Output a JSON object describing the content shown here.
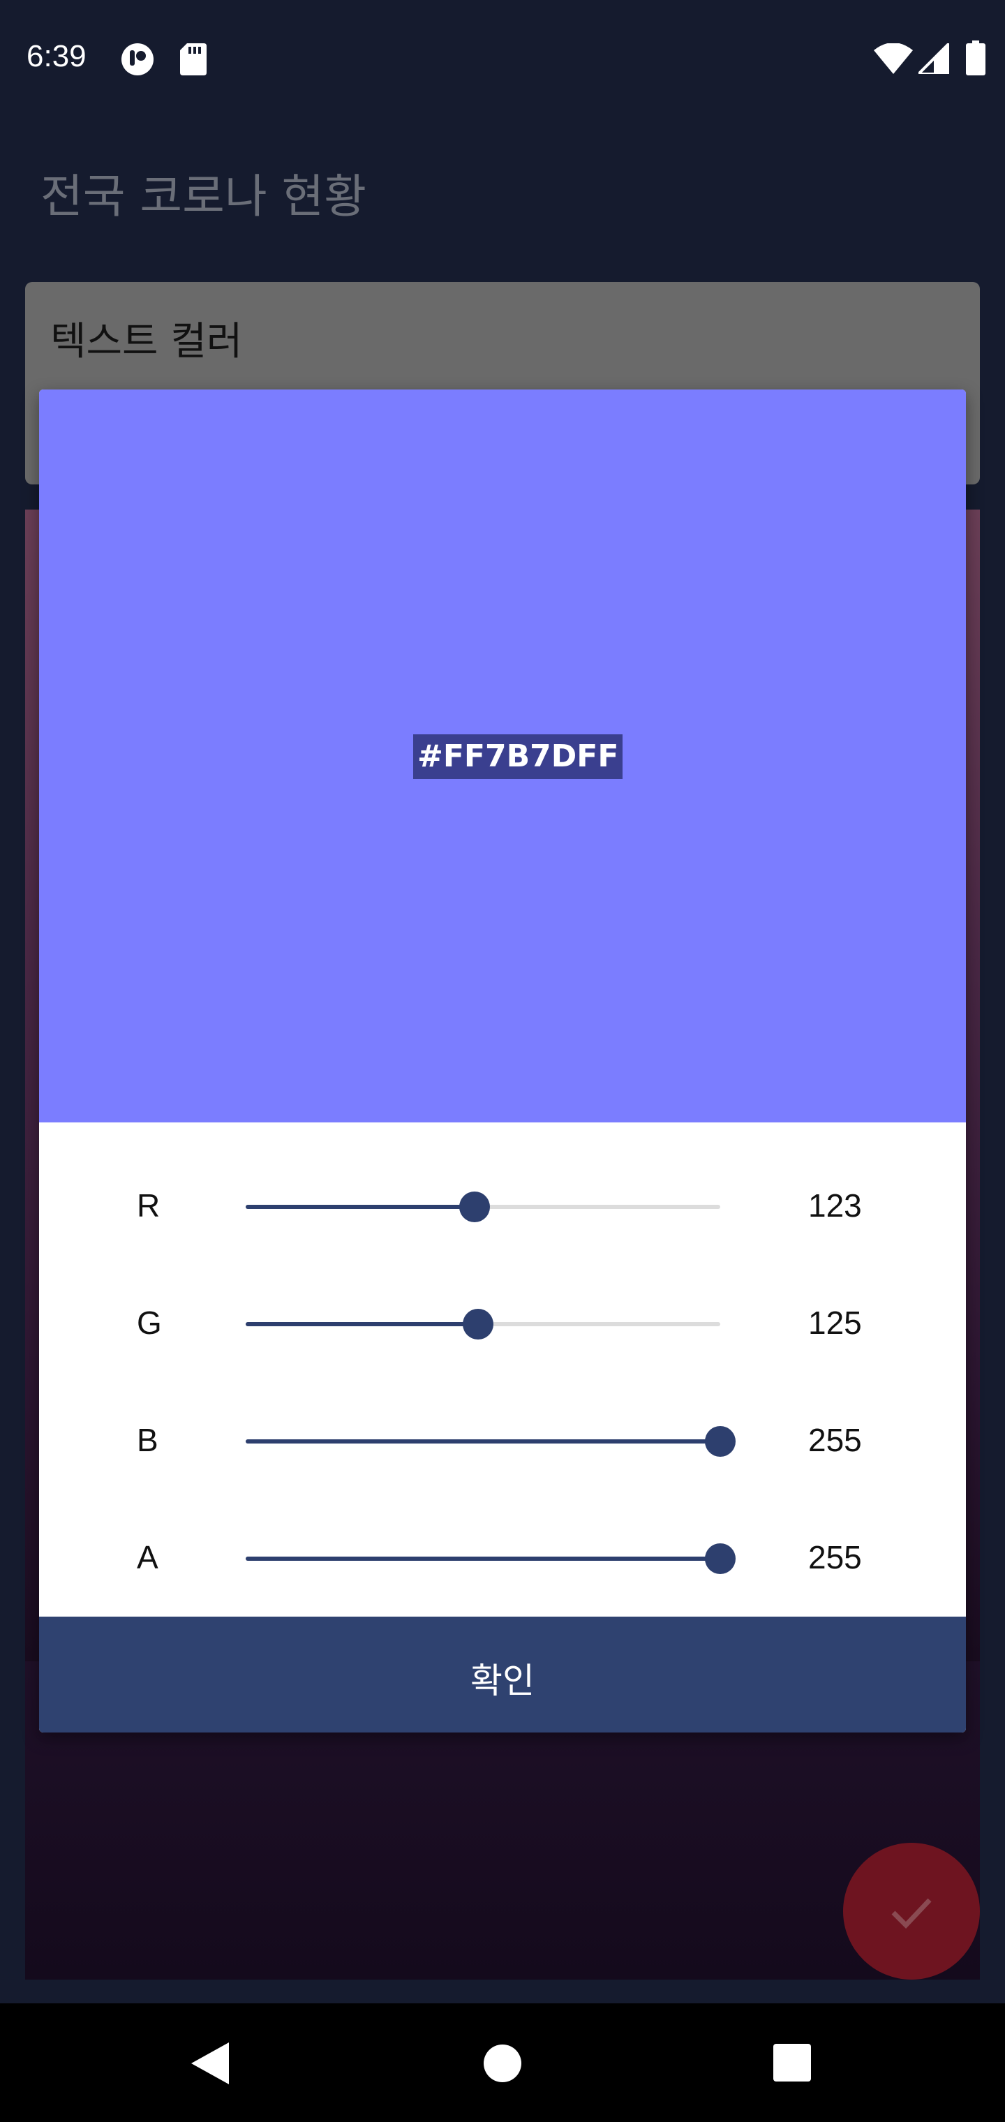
{
  "status_bar": {
    "time": "6:39"
  },
  "app_bar": {
    "title": "전국 코로나 현황"
  },
  "background_card": {
    "title": "텍스트 컬러"
  },
  "color_dialog": {
    "hex": "#FF7B7DFF",
    "preview_color": "#7b7dff",
    "channels": [
      {
        "label": "R",
        "value": "123",
        "level": 0.482
      },
      {
        "label": "G",
        "value": "125",
        "level": 0.49
      },
      {
        "label": "B",
        "value": "255",
        "level": 1.0
      },
      {
        "label": "A",
        "value": "255",
        "level": 1.0
      }
    ],
    "confirm_label": "확인"
  },
  "colors": {
    "accent": "#2f4270",
    "fab": "#6e1420"
  },
  "icons": {
    "fab": "check-icon",
    "nav_back": "back-triangle-icon",
    "nav_home": "home-circle-icon",
    "nav_recents": "recents-square-icon"
  }
}
